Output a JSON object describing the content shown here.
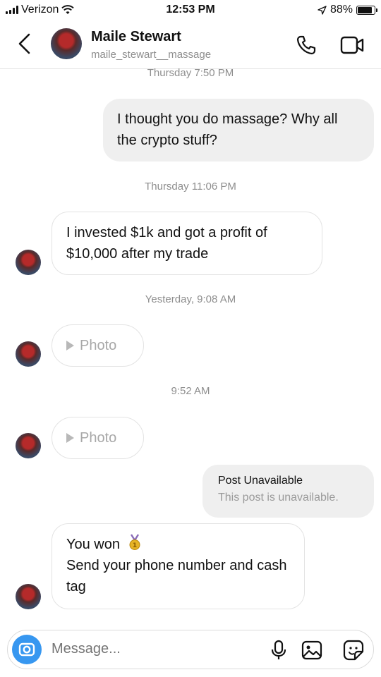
{
  "status_bar": {
    "carrier": "Verizon",
    "time": "12:53 PM",
    "battery_percent": "88%",
    "battery_level": 0.88
  },
  "header": {
    "name": "Maile Stewart",
    "handle": "maile_stewart__massage"
  },
  "messages": {
    "ts_thu_1": "Thursday 7:50 PM",
    "me_1": "I thought you do massage? Why all the crypto stuff?",
    "ts_thu_2": "Thursday 11:06 PM",
    "them_1": "I invested $1k and got a profit of $10,000 after my trade",
    "ts_yesterday": "Yesterday, 9:08 AM",
    "photo_1": "Photo",
    "ts_952": "9:52 AM",
    "photo_2": "Photo",
    "post_title": "Post Unavailable",
    "post_sub": "This post is unavailable.",
    "them_2_line1": "You won",
    "them_2_line2": "Send your phone number and cash tag"
  },
  "composer": {
    "placeholder": "Message..."
  },
  "icons": {
    "back": "chevron-left-icon",
    "call": "phone-icon",
    "video": "video-icon",
    "camera": "camera-icon",
    "mic": "microphone-icon",
    "gallery": "image-icon",
    "sticker": "sticker-icon",
    "medal": "medal-icon"
  },
  "colors": {
    "accent": "#3797f0",
    "bubble_me": "#efefef",
    "meta_gray": "#8e8e8e"
  }
}
